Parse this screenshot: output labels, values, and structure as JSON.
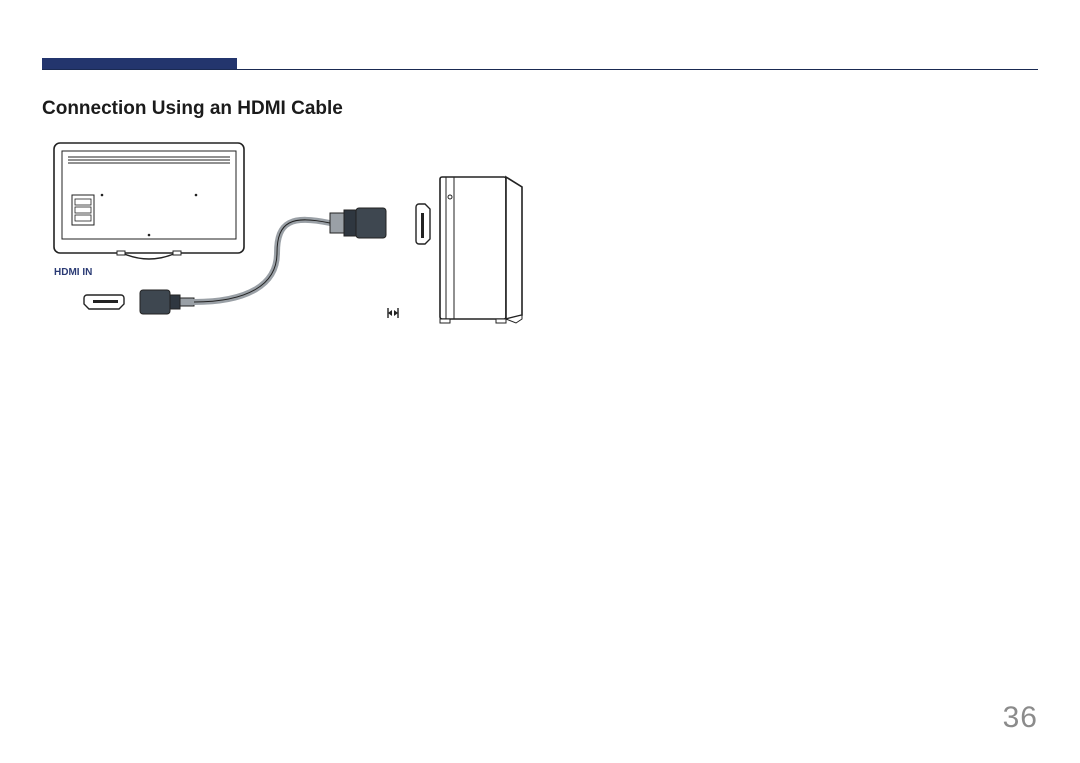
{
  "header": {
    "accent_color": "#23356d"
  },
  "section": {
    "title": "Connection Using an HDMI Cable"
  },
  "diagram": {
    "port_label": "HDMI IN"
  },
  "page_number": "36"
}
